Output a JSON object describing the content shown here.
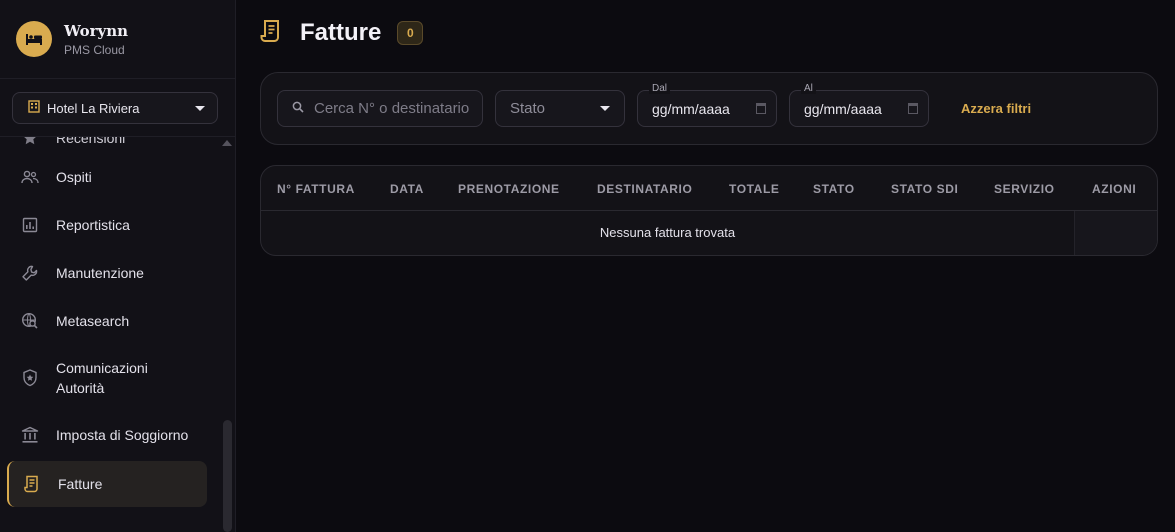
{
  "brand": {
    "name": "Worynn",
    "subtitle": "PMS Cloud"
  },
  "hotel_selector": {
    "value": "Hotel La Riviera"
  },
  "sidebar": {
    "items": [
      {
        "label": "Recensioni",
        "icon": "star-icon"
      },
      {
        "label": "Ospiti",
        "icon": "people-icon"
      },
      {
        "label": "Reportistica",
        "icon": "chart-icon"
      },
      {
        "label": "Manutenzione",
        "icon": "wrench-icon"
      },
      {
        "label": "Metasearch",
        "icon": "globe-search-icon"
      },
      {
        "label_line1": "Comunicazioni",
        "label_line2": "Autorità",
        "icon": "shield-star-icon"
      },
      {
        "label": "Imposta di Soggiorno",
        "icon": "bank-icon"
      },
      {
        "label": "Fatture",
        "icon": "receipt-icon",
        "active": true
      }
    ]
  },
  "page": {
    "title": "Fatture",
    "count": "0"
  },
  "filters": {
    "search_placeholder": "Cerca N° o destinatario",
    "status_placeholder": "Stato",
    "from_label": "Dal",
    "from_value": "gg/mm/aaaa",
    "to_label": "Al",
    "to_value": "gg/mm/aaaa",
    "reset_label": "Azzera filtri"
  },
  "table": {
    "columns": [
      "N° FATTURA",
      "DATA",
      "PRENOTAZIONE",
      "DESTINATARIO",
      "TOTALE",
      "STATO",
      "STATO SDI",
      "SERVIZIO",
      "AZIONI"
    ],
    "empty_message": "Nessuna fattura trovata"
  },
  "colors": {
    "accent": "#d9ab4f",
    "background": "#0c0b10",
    "sidebar": "#121117"
  }
}
